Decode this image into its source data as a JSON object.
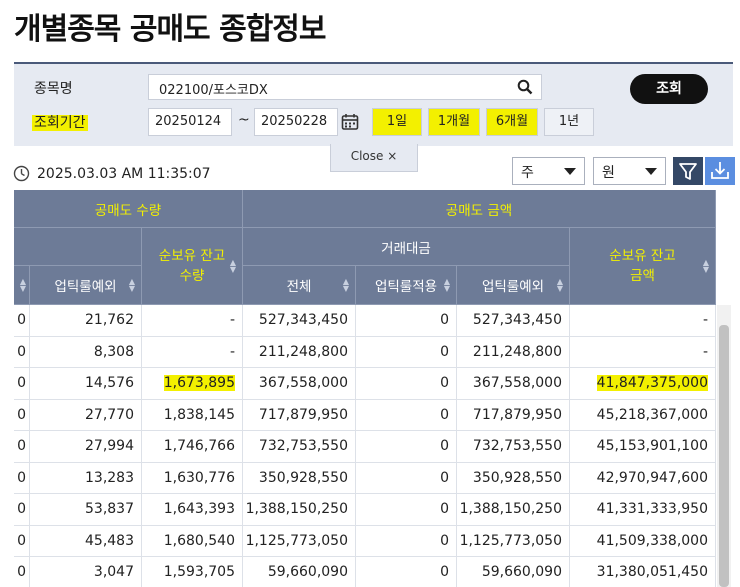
{
  "page": {
    "title": "개별종목 공매도 종합정보"
  },
  "search": {
    "stock_label": "종목명",
    "stock_value": "022100/포스코DX",
    "period_label": "조회기간",
    "date_from": "20250124",
    "tilde": "~",
    "date_to": "20250228",
    "query_button": "조회",
    "periods": [
      "1일",
      "1개월",
      "6개월",
      "1년"
    ],
    "close_label": "Close ×"
  },
  "toolbar": {
    "timestamp": "2025.03.03 AM 11:35:07",
    "unit_select": "주",
    "currency_select": "원"
  },
  "table": {
    "group_headers": {
      "quantity": "공매도 수량",
      "amount": "공매도 금액",
      "trade_amount": "거래대금"
    },
    "columns": {
      "c0": "",
      "c1": "업틱룰예외",
      "c2": "순보유 잔고수량",
      "c3": "전체",
      "c4": "업틱룰적용",
      "c5": "업틱룰예외",
      "c6": "순보유 잔고금액"
    },
    "rows": [
      [
        "0",
        "21,762",
        "-",
        "527,343,450",
        "0",
        "527,343,450",
        "-"
      ],
      [
        "0",
        "8,308",
        "-",
        "211,248,800",
        "0",
        "211,248,800",
        "-"
      ],
      [
        "0",
        "14,576",
        "1,673,895",
        "367,558,000",
        "0",
        "367,558,000",
        "41,847,375,000"
      ],
      [
        "0",
        "27,770",
        "1,838,145",
        "717,879,950",
        "0",
        "717,879,950",
        "45,218,367,000"
      ],
      [
        "0",
        "27,994",
        "1,746,766",
        "732,753,550",
        "0",
        "732,753,550",
        "45,153,901,100"
      ],
      [
        "0",
        "13,283",
        "1,630,776",
        "350,928,550",
        "0",
        "350,928,550",
        "42,970,947,600"
      ],
      [
        "0",
        "53,837",
        "1,643,393",
        "1,388,150,250",
        "0",
        "1,388,150,250",
        "41,331,333,950"
      ],
      [
        "0",
        "45,483",
        "1,680,540",
        "1,125,773,050",
        "0",
        "1,125,773,050",
        "41,509,338,000"
      ],
      [
        "0",
        "3,047",
        "1,593,705",
        "59,660,090",
        "0",
        "59,660,090",
        "31,380,051,450"
      ]
    ]
  },
  "colors": {
    "header_bg": "#6d7b97",
    "highlight": "#f3f000",
    "panel_bg": "#e6eaf2"
  }
}
